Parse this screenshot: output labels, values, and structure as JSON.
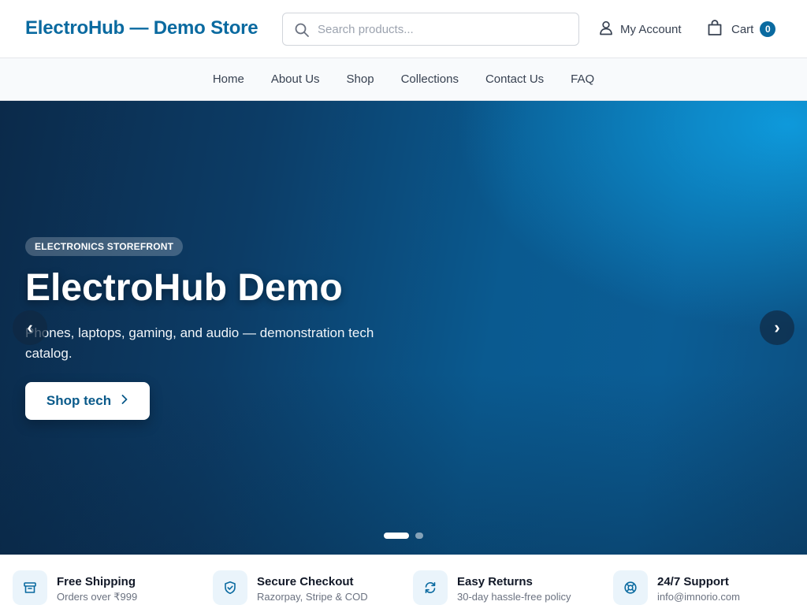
{
  "header": {
    "logo": "ElectroHub — Demo Store",
    "search_placeholder": "Search products...",
    "account_label": "My Account",
    "cart_label": "Cart",
    "cart_count": "0"
  },
  "nav": {
    "items": [
      "Home",
      "About Us",
      "Shop",
      "Collections",
      "Contact Us",
      "FAQ"
    ]
  },
  "hero": {
    "badge": "ELECTRONICS STOREFRONT",
    "title": "ElectroHub Demo",
    "subtitle": "Phones, laptops, gaming, and audio — demonstration tech catalog.",
    "cta_label": "Shop tech",
    "prev_arrow": "‹",
    "next_arrow": "›",
    "slide_count": 2,
    "active_slide": 1
  },
  "features": [
    {
      "title": "Free Shipping",
      "subtitle": "Orders over ₹999",
      "icon": "box-icon"
    },
    {
      "title": "Secure Checkout",
      "subtitle": "Razorpay, Stripe & COD",
      "icon": "shield-check-icon"
    },
    {
      "title": "Easy Returns",
      "subtitle": "30-day hassle-free policy",
      "icon": "refresh-icon"
    },
    {
      "title": "24/7 Support",
      "subtitle": "info@imnorio.com",
      "icon": "lifebuoy-icon"
    }
  ],
  "colors": {
    "brand": "#0a6aa0",
    "hero_dark": "#0b2a4a",
    "hero_light": "#0ea5e9"
  }
}
